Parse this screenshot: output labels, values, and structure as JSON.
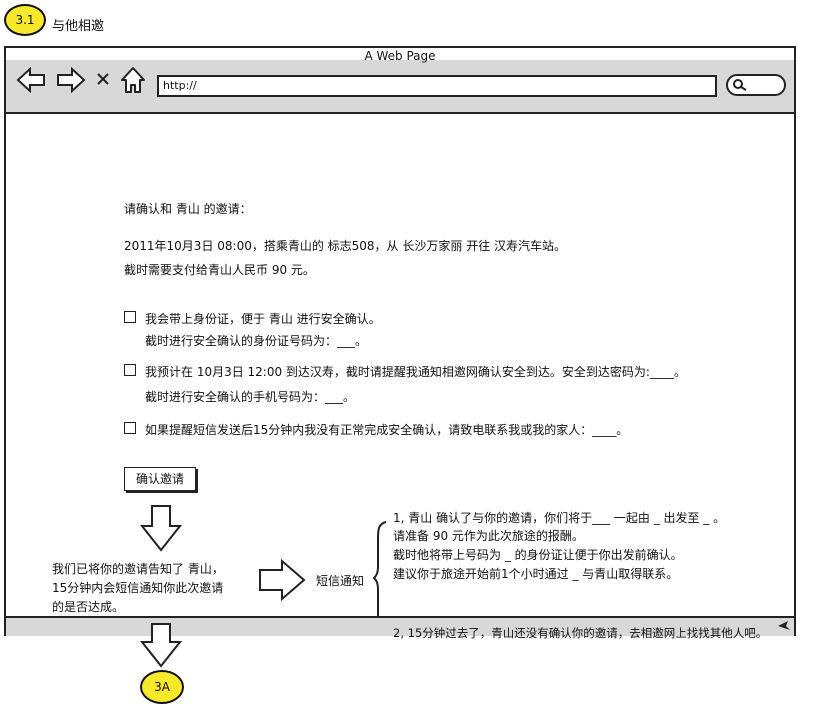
{
  "step": {
    "badge": "3.1",
    "title": "与他相邀",
    "next_badge": "3A"
  },
  "browser": {
    "window_title": "A Web Page",
    "url": "http://"
  },
  "page": {
    "heading": "请确认和 青山 的邀请：",
    "trip_line": "2011年10月3日 08:00，搭乘青山的 标志508，从 长沙万家丽 开往 汉寿汽车站。",
    "payment_line": "截时需要支付给青山人民币 90 元。",
    "options": [
      {
        "line1": "我会带上身份证，便于 青山 进行安全确认。",
        "line2": "截时进行安全确认的身份证号码为：___。"
      },
      {
        "line1": "我预计在 10月3日 12:00 到达汉寿，截时请提醒我通知相邀网确认安全到达。安全到达密码为:____。",
        "line2": "截时进行安全确认的手机号码为：___。"
      },
      {
        "line1": "如果提醒短信发送后15分钟内我没有正常完成安全确认，请致电联系我或我的家人：____。",
        "line2": ""
      }
    ],
    "confirm_button": "确认邀请"
  },
  "annotations": {
    "notice_lines": [
      "我们已将你的邀请告知了 青山，",
      "15分钟内会短信通知你此次邀请",
      "的是否达成。"
    ],
    "sms_label": "短信通知",
    "sms_case1": [
      "1, 青山 确认了与你的邀请，你们将于___ 一起由 _ 出发至 _ 。",
      "请准备 90 元作为此次旅途的报酬。",
      "截时他将带上号码为 _ 的身份证让便于你出发前确认。",
      "建议你于旅途开始前1个小时通过 _ 与青山取得联系。"
    ],
    "sms_case2": "2, 15分钟过去了，青山还没有确认你的邀请，去相邀网上找找其他人吧。"
  },
  "icons": {
    "back": "back-arrow-icon",
    "forward": "forward-arrow-icon",
    "close": "close-icon",
    "home": "home-icon",
    "search": "search-icon",
    "resize": "resize-grip-icon"
  },
  "colors": {
    "badge_fill": "#f6e82a",
    "chrome_gray": "#d8d8d8"
  }
}
